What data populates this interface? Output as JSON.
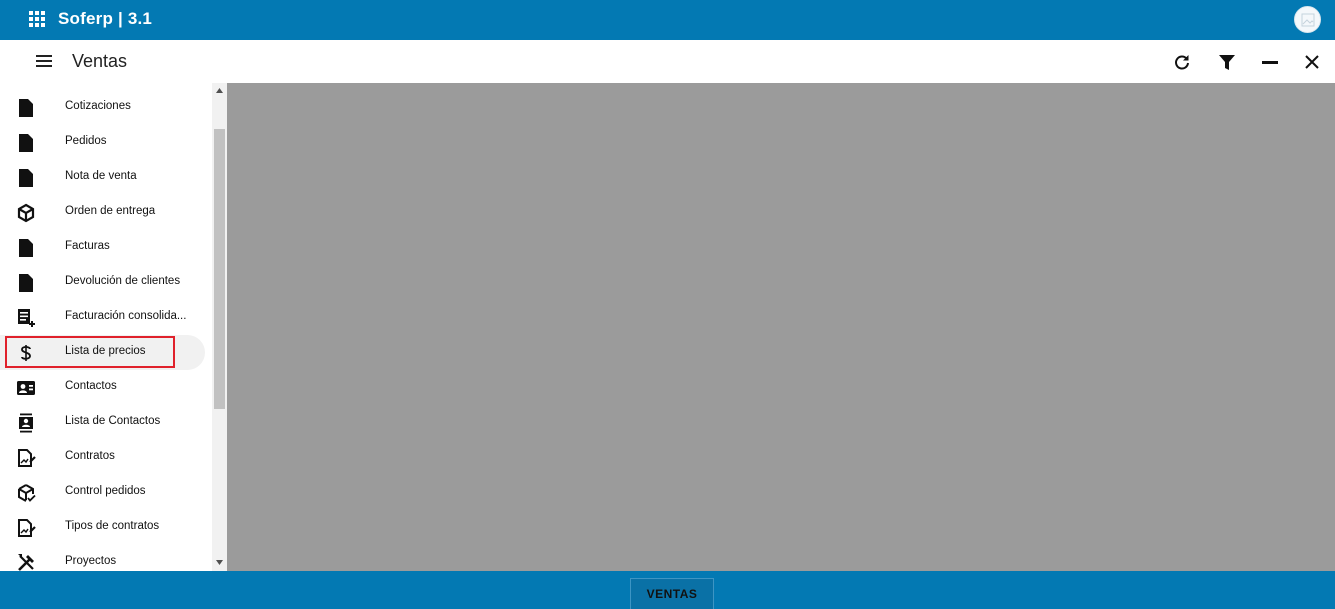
{
  "app": {
    "title": "Soferp | 3.1"
  },
  "header": {
    "title": "Ventas"
  },
  "sidebar": {
    "items": [
      {
        "label": "Cotizaciones",
        "icon": "document-icon"
      },
      {
        "label": "Pedidos",
        "icon": "document-icon"
      },
      {
        "label": "Nota de venta",
        "icon": "document-icon"
      },
      {
        "label": "Orden de entrega",
        "icon": "package-icon"
      },
      {
        "label": "Facturas",
        "icon": "document-icon"
      },
      {
        "label": "Devolución de clientes",
        "icon": "document-icon"
      },
      {
        "label": "Facturación consolida...",
        "icon": "list-add-icon"
      },
      {
        "label": "Lista de precios",
        "icon": "dollar-icon",
        "active": true
      },
      {
        "label": "Contactos",
        "icon": "contact-card-icon"
      },
      {
        "label": "Lista de Contactos",
        "icon": "contact-list-icon"
      },
      {
        "label": "Contratos",
        "icon": "contract-icon"
      },
      {
        "label": "Control pedidos",
        "icon": "package-check-icon"
      },
      {
        "label": "Tipos de contratos",
        "icon": "contract-icon"
      },
      {
        "label": "Proyectos",
        "icon": "tools-icon"
      }
    ]
  },
  "bottom": {
    "tab_label": "VENTAS"
  },
  "colors": {
    "primary": "#0379b3",
    "content_bg": "#9b9b9b",
    "highlight": "#e0212b"
  }
}
